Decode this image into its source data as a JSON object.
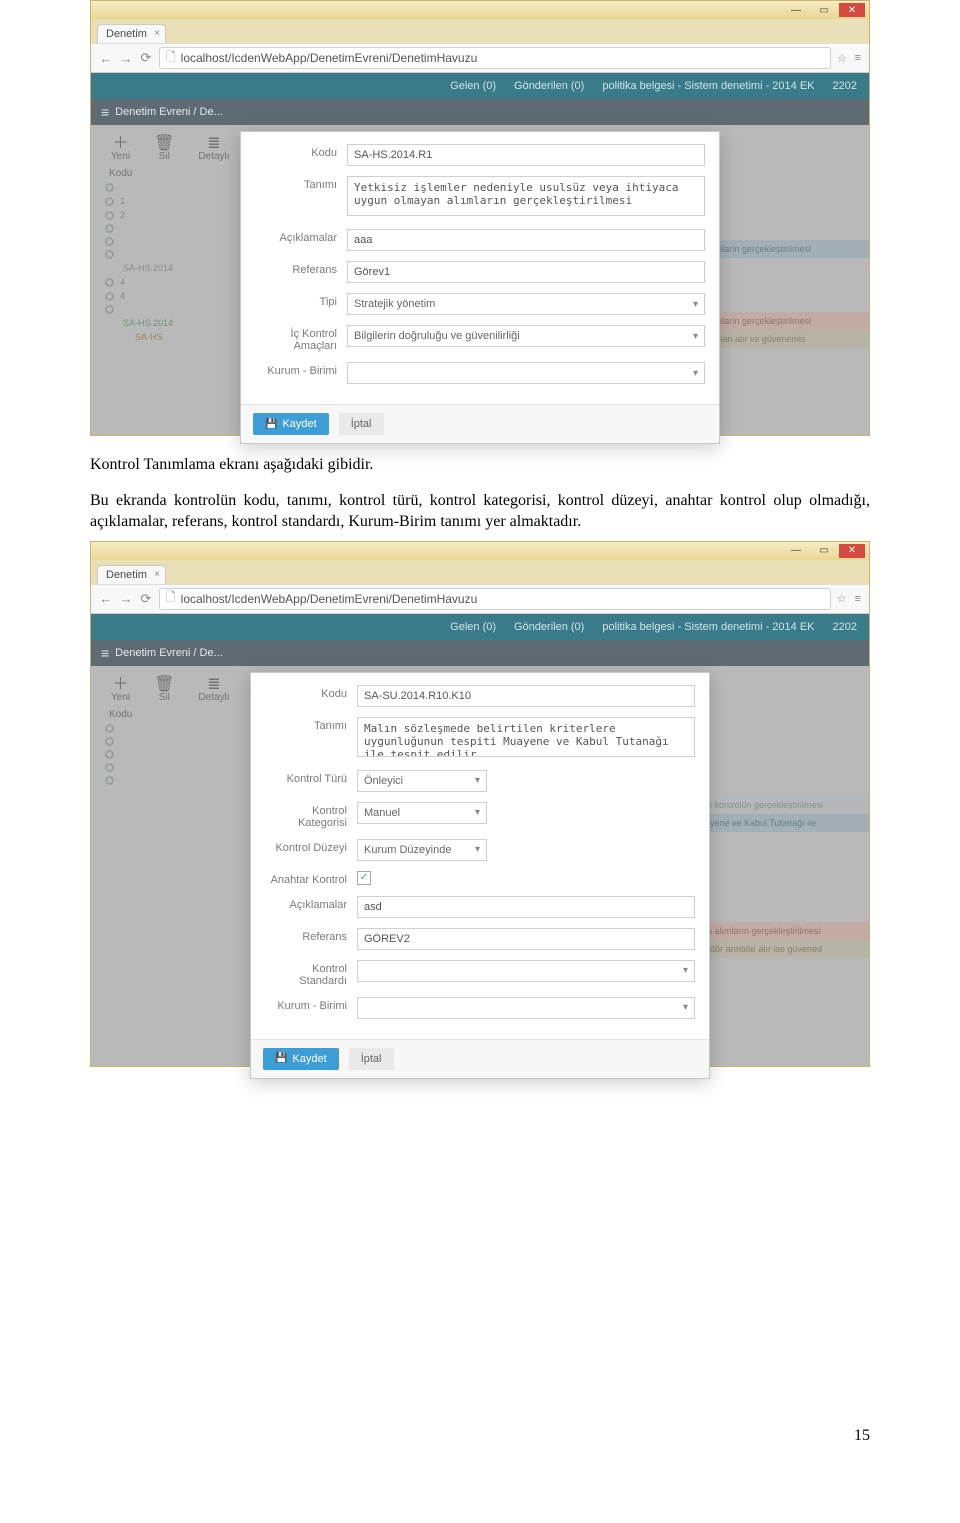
{
  "screenshot1": {
    "tab_title": "Denetim",
    "url": "localhost/IcdenWebApp/DenetimEvreni/DenetimHavuzu",
    "topstrip": [
      "Gelen (0)",
      "Gönderilen (0)",
      "politika belgesi - Sistem denetimi - 2014 EK",
      "2202"
    ],
    "breadcrumb": "Denetim Evreni / De...",
    "toolbar": {
      "yeni": "Yeni",
      "sil": "Sil",
      "detayli": "Detaylı"
    },
    "listhdr": "Kodu",
    "rows": [
      "",
      "1",
      "2",
      "",
      "",
      "",
      "SA-HS.2014",
      "4",
      "4",
      "",
      "SA-HS.2014",
      "SA-HS"
    ],
    "modal": {
      "labels": {
        "kodu": "Kodu",
        "tanimi": "Tanımı",
        "aciklamalar": "Açıklamalar",
        "referans": "Referans",
        "tipi": "Tipi",
        "ic_kontrol": "İç Kontrol Amaçları",
        "kurum": "Kurum - Birimi"
      },
      "values": {
        "kodu": "SA-HS.2014.R1",
        "tanimi": "Yetkisiz işlemler nedeniyle usulsüz veya ihtiyaca uygun olmayan alımların gerçekleştirilmesi",
        "aciklamalar": "aaa",
        "referans": "Görev1",
        "tipi": "Stratejik yönetim",
        "ic_kontrol": "Bilgilerin doğruluğu ve güvenilirliği",
        "kurum": ""
      },
      "kaydet": "Kaydet",
      "iptal": "İptal"
    },
    "ghost": [
      "alımların gerçekleştirilmesi",
      "arıtılan alır ve güvenemis"
    ]
  },
  "paragraph1": "Kontrol Tanımlama ekranı aşağıdaki gibidir.",
  "paragraph2": "Bu ekranda kontrolün kodu, tanımı, kontrol türü, kontrol kategorisi, kontrol düzeyi, anahtar kontrol olup olmadığı, açıklamalar, referans, kontrol standardı, Kurum-Birim tanımı yer almaktadır.",
  "screenshot2": {
    "tab_title": "Denetim",
    "url": "localhost/IcdenWebApp/DenetimEvreni/DenetimHavuzu",
    "topstrip": [
      "Gelen (0)",
      "Gönderilen (0)",
      "politika belgesi - Sistem denetimi - 2014 EK",
      "2202"
    ],
    "breadcrumb": "Denetim Evreni / De...",
    "toolbar": {
      "yeni": "Yeni",
      "sil": "Sil",
      "detayli": "Detaylı"
    },
    "listhdr": "Kodu",
    "modal": {
      "labels": {
        "kodu": "Kodu",
        "tanimi": "Tanımı",
        "kontrol_turu": "Kontrol Türü",
        "kontrol_kategorisi": "Kontrol Kategorisi",
        "kontrol_duzeyi": "Kontrol Düzeyi",
        "anahtar_kontrol": "Anahtar Kontrol",
        "aciklamalar": "Açıklamalar",
        "referans": "Referans",
        "kontrol_standardi": "Kontrol Standardı",
        "kurum": "Kurum - Birimi"
      },
      "values": {
        "kodu": "SA-SU.2014.R10.K10",
        "tanimi": "Malın sözleşmede belirtilen kriterlere uygunluğunun tespiti Muayene ve Kabul Tutanağı ile tespit edilir.",
        "kontrol_turu": "Önleyici",
        "kontrol_kategorisi": "Manuel",
        "kontrol_duzeyi": "Kurum Düzeyinde",
        "anahtar_kontrol_checked": true,
        "aciklamalar": "asd",
        "referans": "GÖREV2",
        "kontrol_standardi": "",
        "kurum": ""
      },
      "kaydet": "Kaydet",
      "iptal": "İptal"
    },
    "ghost": [
      "in kontrolün gerçekleştirilmesi",
      "ayene ve Kabul Tutanağı ile",
      "in alımların gerçekleştirilmesi",
      "edör arıntılar alır ise güvened"
    ]
  },
  "page_number": "15"
}
